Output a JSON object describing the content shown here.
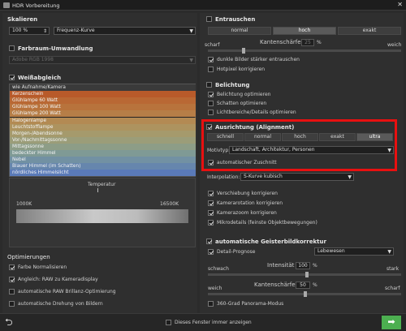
{
  "window": {
    "title": "HDR Vorbereitung",
    "close_glyph": "✕"
  },
  "skalieren": {
    "title": "Skalieren",
    "value": "100 %",
    "method": "Frequenz-Kurve"
  },
  "farbraum": {
    "title": "Farbraum-Umwandlung",
    "value": "Adobe RGB 1998"
  },
  "weissabgleich": {
    "title": "Weißabgleich",
    "items": [
      {
        "label": "wie Aufnahme/Kamera",
        "color": "#d8d8d8"
      },
      {
        "label": "Kerzenschein",
        "color": "#b85a2a"
      },
      {
        "label": "Glühlampe 60 Watt",
        "color": "#b96834"
      },
      {
        "label": "Glühlampe 100 Watt",
        "color": "#b8733c"
      },
      {
        "label": "Glühlampe 200 Watt",
        "color": "#b67e47"
      },
      {
        "label": "Halogenlampe",
        "color": "#b38a53"
      },
      {
        "label": "Leuchtstofflampe",
        "color": "#ad935f"
      },
      {
        "label": "Morgen-/Abendsonne",
        "color": "#a59a6c"
      },
      {
        "label": "Vor-/Nachmittagssonne",
        "color": "#9b9d79"
      },
      {
        "label": "Mittagssonne",
        "color": "#8d9d87"
      },
      {
        "label": "bedeckter Himmel",
        "color": "#7f9a95"
      },
      {
        "label": "Nebel",
        "color": "#7291a3"
      },
      {
        "label": "Blauer Himmel (im Schatten)",
        "color": "#6686ad"
      },
      {
        "label": "nördliches Himmelslicht",
        "color": "#5a7ab8"
      }
    ],
    "temp_title": "Temperatur",
    "temp_min": "1000K",
    "temp_max": "16500K"
  },
  "optimierungen": {
    "title": "Optimierungen",
    "items": [
      {
        "label": "Farbe Normalisieren",
        "checked": true
      },
      {
        "label": "Angleich: RAW zu Kameradisplay",
        "checked": true
      },
      {
        "label": "automatische RAW Brillanz-Optimierung",
        "checked": false
      },
      {
        "label": "automatische Drehung von Bildern",
        "checked": false
      }
    ]
  },
  "entrauschen": {
    "title": "Entrauschen",
    "modes": [
      "normal",
      "hoch",
      "exakt"
    ],
    "selected_mode": "hoch",
    "left": "scharf",
    "right": "weich",
    "sharpness_label": "Kantenschärfe",
    "sharpness_value": "25",
    "unit": "%",
    "options": [
      {
        "label": "dunkle Bilder stärker entrauschen",
        "checked": true
      },
      {
        "label": "Hotpixel korrigieren",
        "checked": false
      }
    ]
  },
  "belichtung": {
    "title": "Belichtung",
    "options": [
      {
        "label": "Belichtung optimieren",
        "checked": true
      },
      {
        "label": "Schatten optimieren",
        "checked": false
      },
      {
        "label": "Lichtbereiche/Details optimieren",
        "checked": false
      }
    ]
  },
  "ausrichtung": {
    "title": "Ausrichtung (Alignment)",
    "modes": [
      "schnell",
      "normal",
      "hoch",
      "exakt",
      "ultra"
    ],
    "selected_mode": "ultra",
    "motiv_label": "Motivtyp:",
    "motiv_value": "Landschaft, Architektur, Personen",
    "auto_crop": "automatischer Zuschnitt",
    "interp_label": "Interpolation:",
    "interp_value": "S-Kurve kubisch",
    "options": [
      {
        "label": "Verschiebung korrigieren",
        "checked": true
      },
      {
        "label": "Kamerarotation korrigieren",
        "checked": true
      },
      {
        "label": "Kamerazoom korrigieren",
        "checked": true
      },
      {
        "label": "Mikrodetails (feinste Objektbewegungen)",
        "checked": true
      }
    ]
  },
  "geister": {
    "title": "automatische Geisterbildkorrektur",
    "detail_label": "Detail-Prognose",
    "detail_value": "Lebewesen",
    "left1": "schwach",
    "right1": "stark",
    "intensity_label": "Intensität",
    "intensity_value": "100",
    "left2": "weich",
    "right2": "scharf",
    "sharp_label": "Kantenschärfe",
    "sharp_value": "50",
    "unit": "%",
    "panorama": "360-Grad Panorama-Modus"
  },
  "footer": {
    "remember": "Dieses Fenster immer anzeigen"
  },
  "colors": {
    "highlight": "#e81010",
    "ok_button": "#4caf50"
  }
}
